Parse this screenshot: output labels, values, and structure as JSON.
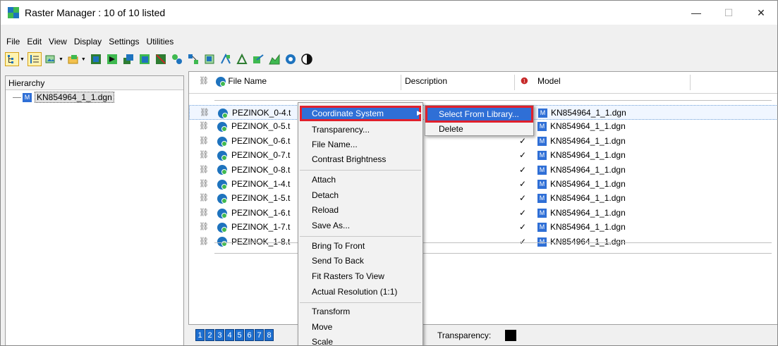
{
  "window": {
    "title": "Raster Manager : 10 of 10 listed",
    "minimize": "—",
    "maximize": "☐",
    "close": "✕"
  },
  "menu": [
    "File",
    "Edit",
    "View",
    "Display",
    "Settings",
    "Utilities"
  ],
  "toolbar": {
    "icons": [
      "hierarchy-view-icon",
      "list-view-icon",
      "attach-icon",
      "open-icon",
      "save-icon",
      "tag-icon",
      "layer-icon",
      "image-icon",
      "detach-icon",
      "puzzle-icon",
      "merge-icon",
      "crop-icon",
      "warp-icon",
      "pen-icon",
      "polygon-icon",
      "chart-icon",
      "zoom-icon",
      "contrast-icon"
    ]
  },
  "hierarchy": {
    "header": "Hierarchy",
    "item": "KN854964_1_1.dgn"
  },
  "table": {
    "columns": {
      "file_name": "File Name",
      "description": "Description",
      "model": "Model"
    },
    "rows": [
      {
        "file": "PEZINOK_0-4.t",
        "check": "✓",
        "model": "KN854964_1_1.dgn",
        "selected": true
      },
      {
        "file": "PEZINOK_0-5.t",
        "check": "✓",
        "model": "KN854964_1_1.dgn"
      },
      {
        "file": "PEZINOK_0-6.t",
        "check": "✓",
        "model": "KN854964_1_1.dgn"
      },
      {
        "file": "PEZINOK_0-7.t",
        "check": "✓",
        "model": "KN854964_1_1.dgn"
      },
      {
        "file": "PEZINOK_0-8.t",
        "check": "✓",
        "model": "KN854964_1_1.dgn"
      },
      {
        "file": "PEZINOK_1-4.t",
        "check": "✓",
        "model": "KN854964_1_1.dgn"
      },
      {
        "file": "PEZINOK_1-5.t",
        "check": "✓",
        "model": "KN854964_1_1.dgn"
      },
      {
        "file": "PEZINOK_1-6.t",
        "check": "✓",
        "model": "KN854964_1_1.dgn"
      },
      {
        "file": "PEZINOK_1-7.t",
        "check": "✓",
        "model": "KN854964_1_1.dgn"
      },
      {
        "file": "PEZINOK_1-8.t",
        "check": "✓",
        "model": "KN854964_1_1.dgn"
      }
    ]
  },
  "context_menu": {
    "items": [
      "Coordinate System",
      "Transparency...",
      "File Name...",
      "Contrast Brightness",
      "Attach",
      "Detach",
      "Reload",
      "Save As...",
      "Bring To Front",
      "Send To Back",
      "Fit Rasters To View",
      "Actual Resolution (1:1)",
      "Transform",
      "Move",
      "Scale"
    ]
  },
  "submenu": {
    "items": [
      "Select From Library...",
      "Delete"
    ]
  },
  "bottom": {
    "views": [
      "1",
      "2",
      "3",
      "4",
      "5",
      "6",
      "7",
      "8"
    ],
    "transparency_label": "Transparency:"
  },
  "colors": {
    "highlight": "#2f6fd6",
    "callout_border": "#e0202c"
  }
}
